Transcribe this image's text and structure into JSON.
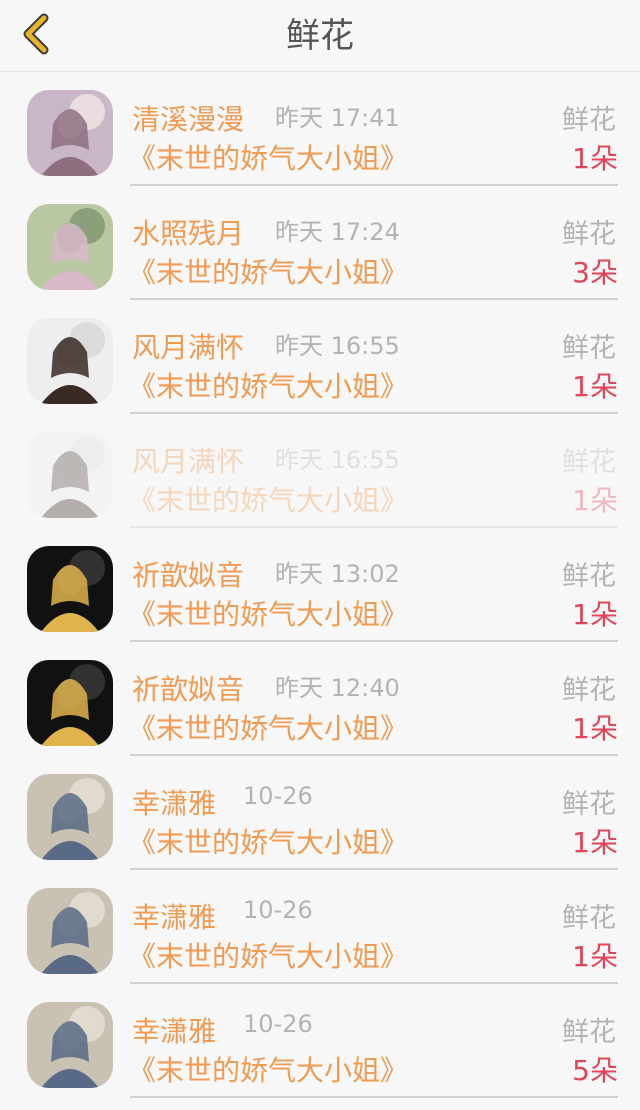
{
  "header": {
    "title": "鲜花"
  },
  "items": [
    {
      "name": "清溪漫漫",
      "time": "昨天 17:41",
      "type": "鲜花",
      "book": "《末世的娇气大小姐》",
      "count": "1朵",
      "faded": false,
      "avatar_palette": [
        "#c9b7c8",
        "#8d6f7f",
        "#f1e6e6"
      ]
    },
    {
      "name": "水照残月",
      "time": "昨天 17:24",
      "type": "鲜花",
      "book": "《末世的娇气大小姐》",
      "count": "3朵",
      "faded": false,
      "avatar_palette": [
        "#b9c8a2",
        "#d9b9c9",
        "#7f9570"
      ]
    },
    {
      "name": "风月满怀",
      "time": "昨天 16:55",
      "type": "鲜花",
      "book": "《末世的娇气大小姐》",
      "count": "1朵",
      "faded": false,
      "avatar_palette": [
        "#eeeeee",
        "#3a2a26",
        "#d7d7d7"
      ]
    },
    {
      "name": "风月满怀",
      "time": "昨天 16:55",
      "type": "鲜花",
      "book": "《末世的娇气大小姐》",
      "count": "1朵",
      "faded": true,
      "avatar_palette": [
        "#eeeeee",
        "#3a2a26",
        "#d7d7d7"
      ]
    },
    {
      "name": "祈歆姒音",
      "time": "昨天 13:02",
      "type": "鲜花",
      "book": "《末世的娇气大小姐》",
      "count": "1朵",
      "faded": false,
      "avatar_palette": [
        "#111111",
        "#e1b34d",
        "#3b3b3b"
      ]
    },
    {
      "name": "祈歆姒音",
      "time": "昨天 12:40",
      "type": "鲜花",
      "book": "《末世的娇气大小姐》",
      "count": "1朵",
      "faded": false,
      "avatar_palette": [
        "#111111",
        "#e1b34d",
        "#3b3b3b"
      ]
    },
    {
      "name": "幸潇雅",
      "time": "10-26",
      "type": "鲜花",
      "book": "《末世的娇气大小姐》",
      "count": "1朵",
      "faded": false,
      "avatar_palette": [
        "#c9c2b2",
        "#586a86",
        "#e7e1d6"
      ]
    },
    {
      "name": "幸潇雅",
      "time": "10-26",
      "type": "鲜花",
      "book": "《末世的娇气大小姐》",
      "count": "1朵",
      "faded": false,
      "avatar_palette": [
        "#c9c2b2",
        "#586a86",
        "#e7e1d6"
      ]
    },
    {
      "name": "幸潇雅",
      "time": "10-26",
      "type": "鲜花",
      "book": "《末世的娇气大小姐》",
      "count": "5朵",
      "faded": false,
      "avatar_palette": [
        "#c9c2b2",
        "#586a86",
        "#e7e1d6"
      ]
    }
  ],
  "colors": {
    "accent": "#f09a52",
    "count": "#e0455a",
    "back_icon": "#e7b52a",
    "muted": "#b3b3b3"
  },
  "icons": {
    "back": "chevron-left-icon"
  }
}
